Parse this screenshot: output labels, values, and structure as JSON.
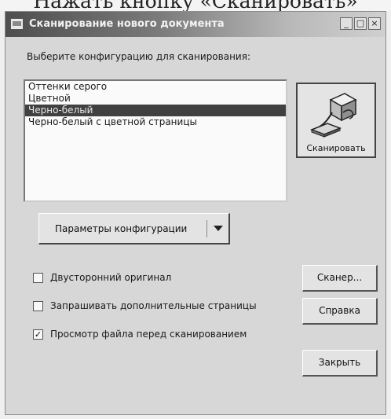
{
  "caption_above": "Нажать кнопку «Сканировать»",
  "window": {
    "title": "Сканирование нового документа",
    "controls": {
      "minimize": "_",
      "maximize": "□",
      "close": "×"
    }
  },
  "config_label": "Выберите конфигурацию для сканирования:",
  "configurations": [
    {
      "label": "Оттенки серого",
      "selected": false
    },
    {
      "label": "Цветной",
      "selected": false
    },
    {
      "label": "Черно-белый",
      "selected": true
    },
    {
      "label": "Черно-белый с цветной страницы",
      "selected": false
    }
  ],
  "scan_button": {
    "label": "Сканировать",
    "icon": "scanner-icon"
  },
  "params_button": {
    "label": "Параметры конфигурации"
  },
  "checkboxes": [
    {
      "label": "Двусторонний оригинал",
      "checked": false,
      "mark": ""
    },
    {
      "label": "Запрашивать дополнительные страницы",
      "checked": false,
      "mark": ""
    },
    {
      "label": "Просмотр файла перед сканированием",
      "checked": true,
      "mark": "✓"
    }
  ],
  "buttons": {
    "scanner": "Сканер...",
    "help": "Справка",
    "close": "Закрыть"
  },
  "colors": {
    "selection": "#404040",
    "window": "#d7d7d7",
    "titlebar_start": "#4e4e4e"
  }
}
